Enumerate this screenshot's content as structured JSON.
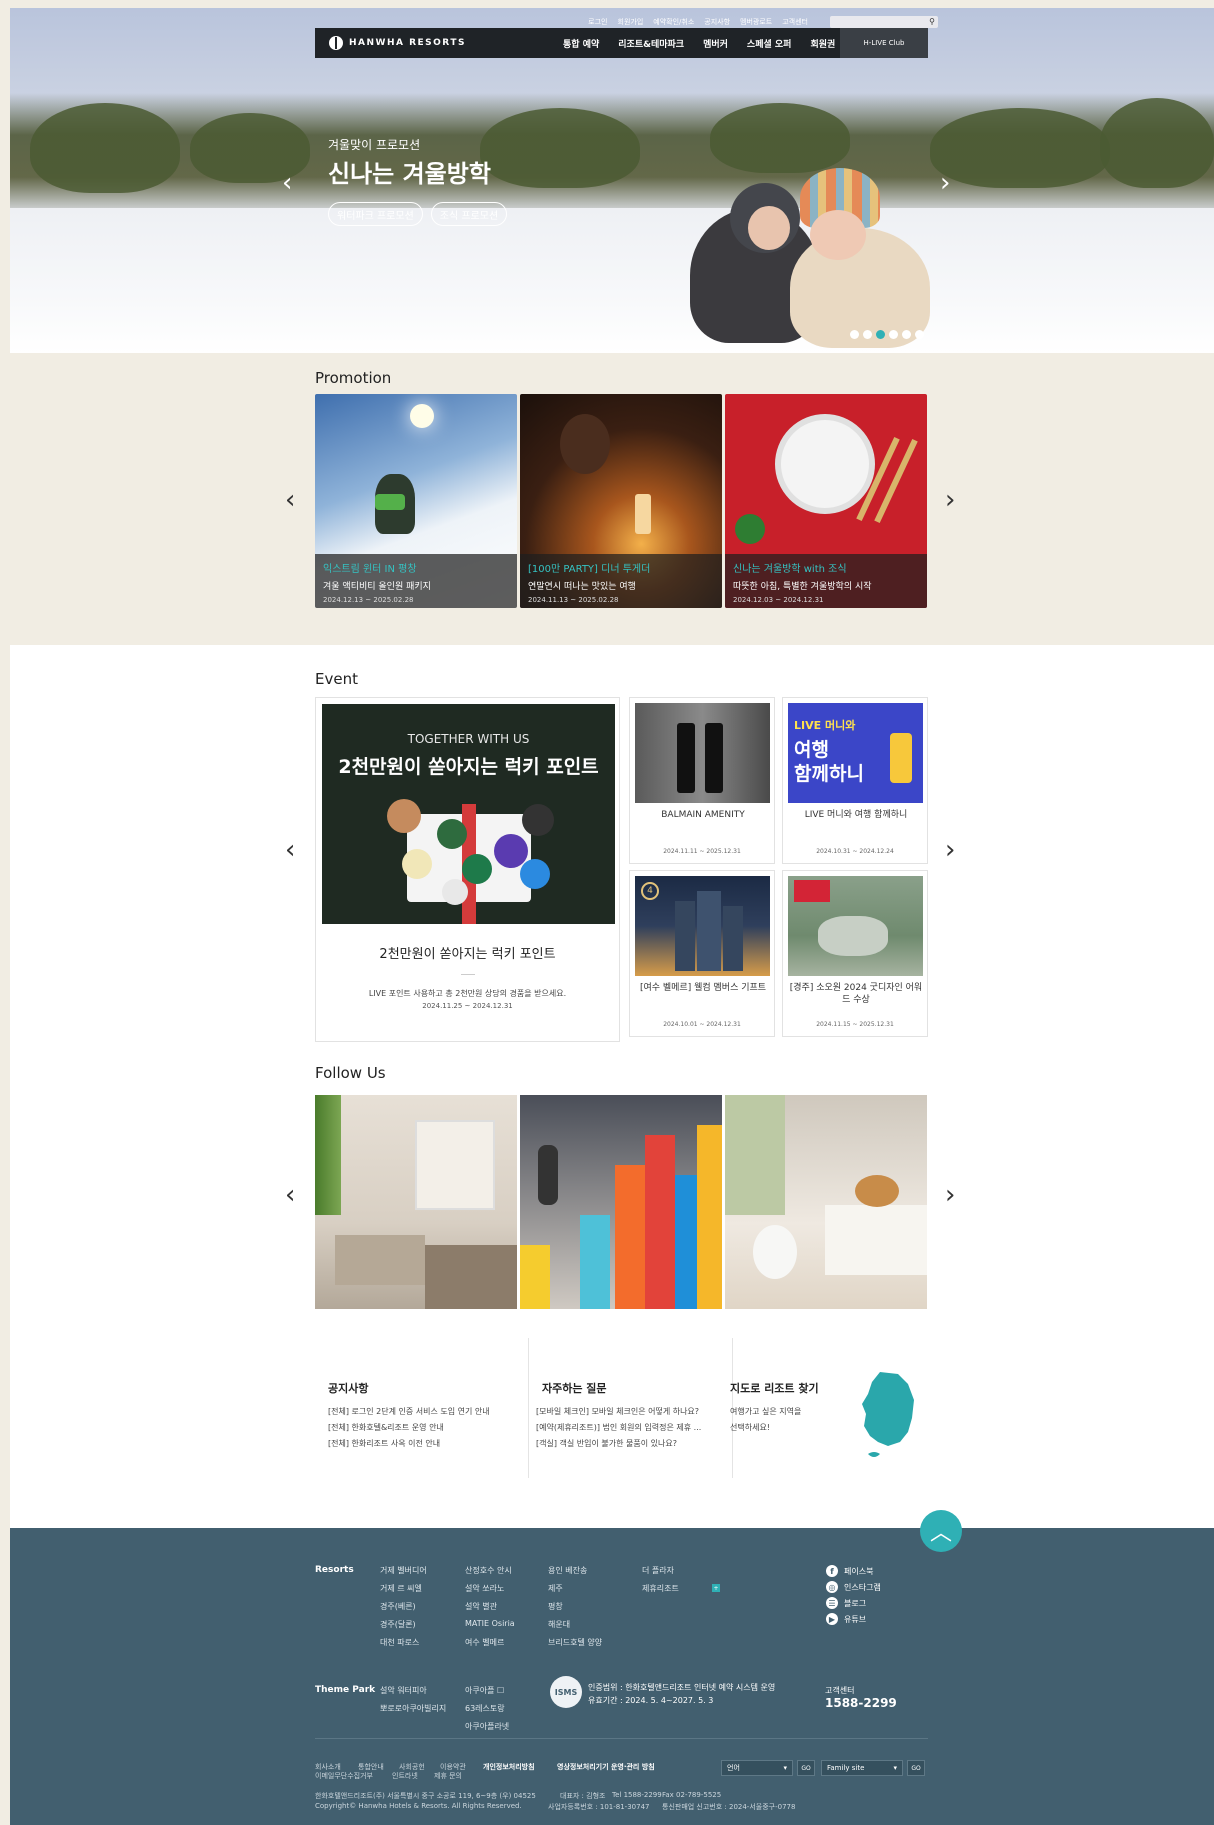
{
  "top_links": [
    "로그인",
    "회원가입",
    "예약확인/취소",
    "공지사항",
    "멤버광로트",
    "고객센터"
  ],
  "brand": "HANWHA RESORTS",
  "gnb": [
    "통합 예약",
    "리조트&테마파크",
    "멤버커",
    "스페셜 오퍼",
    "회원권"
  ],
  "club_label": "H-LIVE Club",
  "hero": {
    "subtitle": "겨울맞이 프로모션",
    "title": "신나는 겨울방학",
    "buttons": [
      "워터파크 프로모션",
      "조식 프로모션"
    ],
    "prev": "‹",
    "next": "›"
  },
  "promotion": {
    "title": "Promotion",
    "cards": [
      {
        "title": "익스트림 윈터 IN 평창",
        "desc": "겨울 액티비티 올인원 패키지",
        "date": "2024.12.13 ~ 2025.02.28"
      },
      {
        "title": "[100만 PARTY] 디너 투게더",
        "desc": "연말연시 떠나는 맛있는 여행",
        "date": "2024.11.13 ~ 2025.02.28"
      },
      {
        "title": "신나는 겨울방학 with 조식",
        "desc": "따뜻한 아침, 특별한 겨울방학의 시작",
        "date": "2024.12.03 ~ 2024.12.31"
      }
    ]
  },
  "event": {
    "title": "Event",
    "main": {
      "img_line1": "TOGETHER WITH US",
      "img_line2": "2천만원이 쏟아지는 럭키 포인트",
      "title": "2천만원이 쏟아지는 럭키 포인트",
      "desc": "LIVE 포인트 사용하고 총 2천만원 상당의 경품을 받으세요.",
      "date": "2024.11.25 ~ 2024.12.31"
    },
    "cards": [
      {
        "name": "BALMAIN AMENITY",
        "date": "2024.11.11 ~ 2025.12.31"
      },
      {
        "name": "LIVE 머니와 여행 함께하니",
        "date": "2024.10.31 ~ 2024.12.24",
        "img_line1": "LIVE 머니와",
        "img_line2": "여행",
        "img_line3": "함께하니"
      },
      {
        "name": "[여수 벨메르] 웰컴 멤버스 기프트",
        "date": "2024.10.01 ~ 2024.12.31"
      },
      {
        "name": "[경주] 소오원 2024 굿디자인 어워드 수상",
        "date": "2024.11.15 ~ 2025.12.31"
      }
    ]
  },
  "follow": {
    "title": "Follow Us"
  },
  "notice": {
    "title": "공지사항",
    "items": [
      "[전체] 로그인 2단계 인증 서비스 도입 연기 안내",
      "[전체] 한화호텔&리조트 운영 안내",
      "[전체] 한화리조트 사옥 이전 안내"
    ]
  },
  "faq": {
    "title": "자주하는 질문",
    "items": [
      "[모바일 체크인] 모바일 체크인은 어떻게 하나요?",
      "[예약(제휴리조트)] 법인 회원의 입력정은 제휴 ...",
      "[객실] 객실 반입이 불가한 물품이 있나요?"
    ]
  },
  "map": {
    "title": "지도로 리조트 찾기",
    "desc_line1": "여행가고 싶은 지역을",
    "desc_line2": "선택하세요!"
  },
  "footer": {
    "resorts_label": "Resorts",
    "resorts_col1": [
      "거제 벨버디어",
      "거제 르 씨엘",
      "경주(베른)",
      "경주(달론)",
      "대천 파로스"
    ],
    "resorts_col2": [
      "산정호수 안시",
      "설악 쏘라노",
      "설악 별관",
      "MATIE Osiria",
      "여수 벨메르"
    ],
    "resorts_col3": [
      "용인 베잔송",
      "제주",
      "평창",
      "해운대",
      "브리드호텔 양양"
    ],
    "resorts_col4": [
      "더 플라자",
      "제휴리조트"
    ],
    "theme_label": "Theme Park",
    "theme_col1": [
      "설악 워터피아",
      "뽀로로아쿠아빌리지"
    ],
    "theme_col2": [
      "아쿠아플 ☐",
      "63레스토랑",
      "아쿠아플라넷"
    ],
    "social": [
      "페이스북",
      "인스타그램",
      "블로그",
      "유튜브"
    ],
    "isms": "ISMS",
    "cert_line1": "인증범위 : 한화호텔앤드리조트 인터넷 예약 시스템 운영",
    "cert_line2": "유효기간 : 2024. 5. 4~2027. 5. 3",
    "cs_label": "고객센터",
    "cs_number": "1588-2299",
    "bottom_links_row1": [
      "회사소개",
      "통합안내",
      "사회공헌",
      "이용약관"
    ],
    "bottom_links_bold": [
      "개인정보처리방침",
      "영상정보처리기기 운영·관리 방침"
    ],
    "bottom_links_row2": [
      "이메일무단수집거부",
      "인트라넷",
      "제휴 문의"
    ],
    "company": "한화호텔앤드리조트(주) 서울특별시 중구 소공로 119, 6~9층 (우) 04525",
    "ceo": "대표자 : 김형조",
    "tel": "Tel 1588-2299",
    "fax": "Fax 02-789-5525",
    "reg": "사업자등록번호 : 101-81-30747",
    "sales": "통신판매업 신고번호 : 2024-서울중구-0778",
    "copyright": "Copyright© Hanwha Hotels & Resorts. All Rights Reserved.",
    "lang_select": "언어",
    "family_select": "Family site",
    "go": "GO"
  }
}
